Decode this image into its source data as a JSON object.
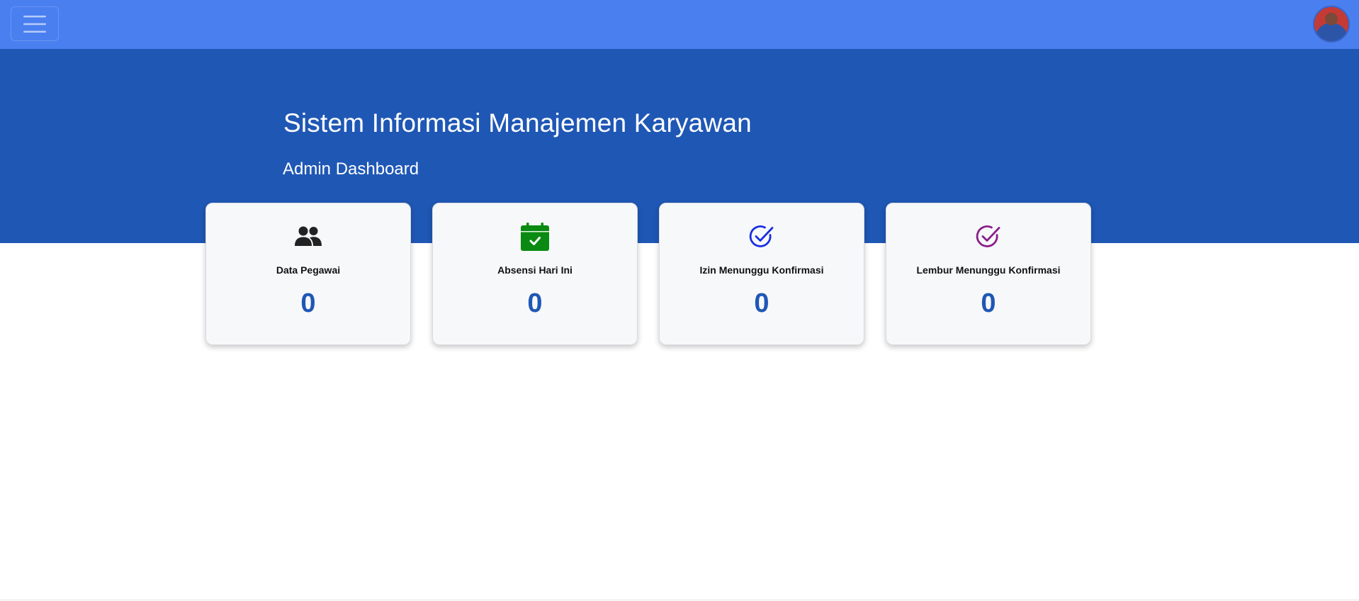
{
  "topbar": {
    "menu_icon": "hamburger-icon",
    "avatar_icon": "user-avatar"
  },
  "hero": {
    "title": "Sistem Informasi Manajemen Karyawan",
    "subtitle": "Admin Dashboard"
  },
  "cards": [
    {
      "icon": "users-icon",
      "icon_color": "#222222",
      "title": "Data Pegawai",
      "value": "0"
    },
    {
      "icon": "calendar-check-icon",
      "icon_color": "#0a8a12",
      "title": "Absensi Hari Ini",
      "value": "0"
    },
    {
      "icon": "check-circle-icon",
      "icon_color": "#1a2ee0",
      "title": "Izin Menunggu Konfirmasi",
      "value": "0"
    },
    {
      "icon": "check-circle-icon",
      "icon_color": "#8a1f8c",
      "title": "Lembur Menunggu Konfirmasi",
      "value": "0"
    }
  ],
  "colors": {
    "topbar": "#4a7ff0",
    "hero": "#1f57b5",
    "value": "#1f57b5"
  }
}
